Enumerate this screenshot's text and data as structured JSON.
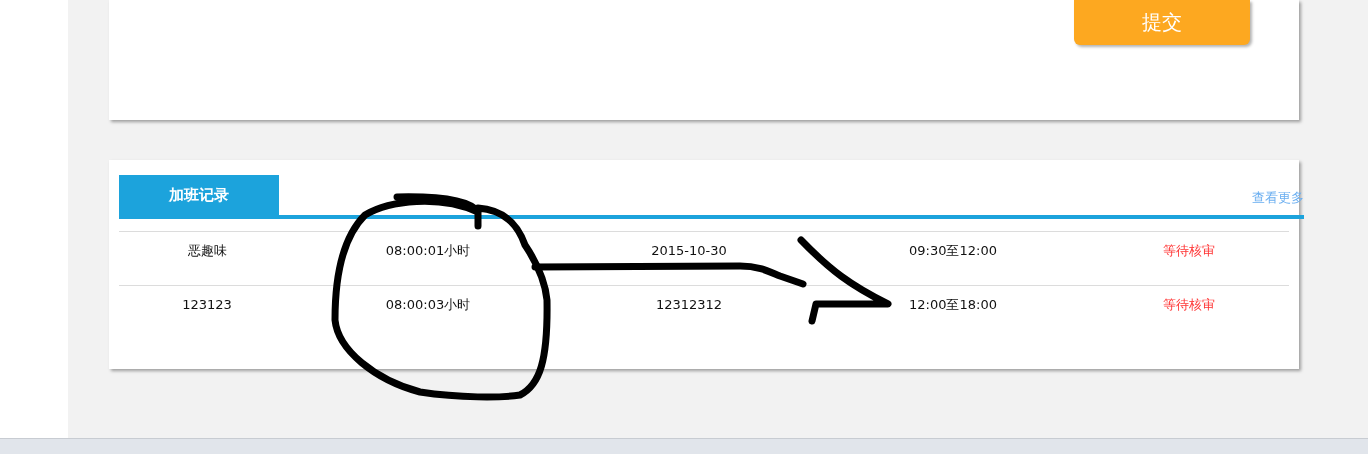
{
  "form_card": {
    "submit_button": "提交"
  },
  "records": {
    "tab": {
      "label": "加班记录",
      "selected": true
    },
    "more_link": "查看更多",
    "rows": [
      {
        "name": "恶趣味",
        "duration": "08:00:01小时",
        "date": "2015-10-30",
        "time_range": "09:30至12:00",
        "status": "等待核审",
        "color": "#ff3333"
      },
      {
        "name": "123123",
        "duration": "08:00:03小时",
        "date": "12312312",
        "time_range": "12:00至18:00",
        "status": "等待核审",
        "color": "#ff3333"
      }
    ]
  }
}
